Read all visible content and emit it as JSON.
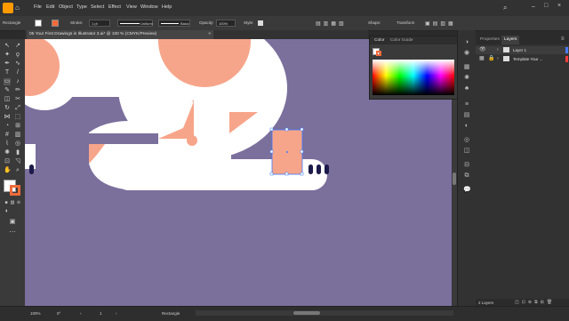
{
  "menu": {
    "items": [
      "File",
      "Edit",
      "Object",
      "Type",
      "Select",
      "Effect",
      "View",
      "Window",
      "Help"
    ]
  },
  "control": {
    "tool_name": "Rectangle",
    "stroke_label": "Stroke:",
    "stroke_value": "1 pt",
    "stroke_profile": "Uniform",
    "brush": "Basic",
    "opacity_label": "Opacity:",
    "opacity_value": "100%",
    "style_label": "Style:",
    "shape_label": "Shape:",
    "transform_label": "Transform"
  },
  "document": {
    "tab_title": "05 Your First Drawings in Illustrator 3.ai* @ 100 % (CMYK/Preview)",
    "close_glyph": "×"
  },
  "color_panel": {
    "tab_color": "Color",
    "tab_guide": "Color Guide"
  },
  "layers_panel": {
    "tab_properties": "Properties",
    "tab_layers": "Layers",
    "layers": [
      {
        "name": "Layer 1",
        "color": "#4a7bff"
      },
      {
        "name": "Template Your ...",
        "color": "#ff3b3b"
      }
    ],
    "count_label": "2 Layers"
  },
  "status": {
    "zoom": "100%",
    "rotation": "0°",
    "artboard": "1",
    "tool": "Rectangle"
  },
  "colors": {
    "canvas": "#7b6f9c",
    "salmon": "#f7a58a",
    "navy": "#1b1a4a",
    "white": "#ffffff",
    "accent": "#f26b3a"
  }
}
